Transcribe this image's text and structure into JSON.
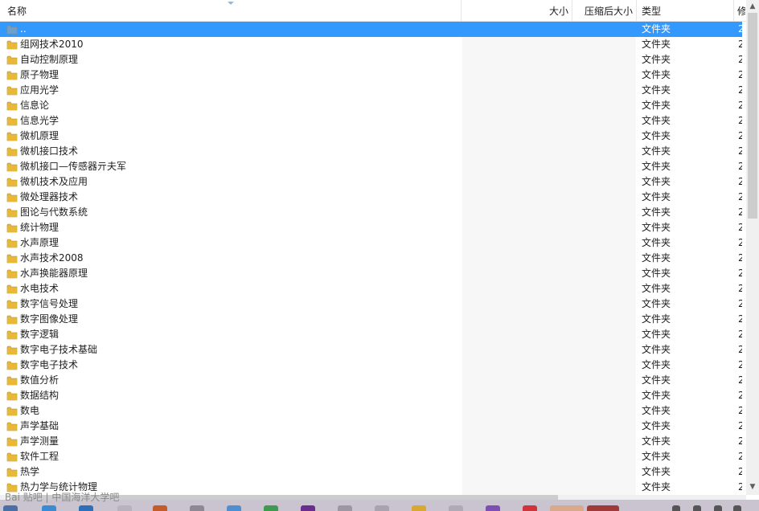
{
  "columns": {
    "name": "名称",
    "size": "大小",
    "compressed_size": "压缩后大小",
    "type": "类型",
    "modified": "修"
  },
  "rows": [
    {
      "name": "..",
      "type": "文件夹",
      "date": "2",
      "selected": true
    },
    {
      "name": "组网技术2010",
      "type": "文件夹",
      "date": "2"
    },
    {
      "name": "自动控制原理",
      "type": "文件夹",
      "date": "2"
    },
    {
      "name": "原子物理",
      "type": "文件夹",
      "date": "2"
    },
    {
      "name": "应用光学",
      "type": "文件夹",
      "date": "2"
    },
    {
      "name": "信息论",
      "type": "文件夹",
      "date": "2"
    },
    {
      "name": "信息光学",
      "type": "文件夹",
      "date": "2"
    },
    {
      "name": "微机原理",
      "type": "文件夹",
      "date": "2"
    },
    {
      "name": "微机接口技术",
      "type": "文件夹",
      "date": "2"
    },
    {
      "name": "微机接口—传感器亓夫军",
      "type": "文件夹",
      "date": "2"
    },
    {
      "name": "微机技术及应用",
      "type": "文件夹",
      "date": "2"
    },
    {
      "name": "微处理器技术",
      "type": "文件夹",
      "date": "2"
    },
    {
      "name": "图论与代数系统",
      "type": "文件夹",
      "date": "2"
    },
    {
      "name": "统计物理",
      "type": "文件夹",
      "date": "2"
    },
    {
      "name": "水声原理",
      "type": "文件夹",
      "date": "2"
    },
    {
      "name": "水声技术2008",
      "type": "文件夹",
      "date": "2"
    },
    {
      "name": "水声换能器原理",
      "type": "文件夹",
      "date": "2"
    },
    {
      "name": "水电技术",
      "type": "文件夹",
      "date": "2"
    },
    {
      "name": "数字信号处理",
      "type": "文件夹",
      "date": "2"
    },
    {
      "name": "数字图像处理",
      "type": "文件夹",
      "date": "2"
    },
    {
      "name": "数字逻辑",
      "type": "文件夹",
      "date": "2"
    },
    {
      "name": "数字电子技术基础",
      "type": "文件夹",
      "date": "2"
    },
    {
      "name": "数字电子技术",
      "type": "文件夹",
      "date": "2"
    },
    {
      "name": "数值分析",
      "type": "文件夹",
      "date": "2"
    },
    {
      "name": "数据结构",
      "type": "文件夹",
      "date": "2"
    },
    {
      "name": "数电",
      "type": "文件夹",
      "date": "2"
    },
    {
      "name": "声学基础",
      "type": "文件夹",
      "date": "2"
    },
    {
      "name": "声学测量",
      "type": "文件夹",
      "date": "2"
    },
    {
      "name": "软件工程",
      "type": "文件夹",
      "date": "2"
    },
    {
      "name": "热学",
      "type": "文件夹",
      "date": "2"
    },
    {
      "name": "热力学与统计物理",
      "type": "文件夹",
      "date": "2"
    }
  ],
  "watermark": "Bai 贴吧 | 中国海洋大学吧",
  "colors": {
    "selection": "#3399ff",
    "folder": "#e8b838",
    "folder_up": "#6d9fcf"
  },
  "icons": {
    "folder": "folder-icon",
    "scroll_up": "scroll-up-icon",
    "scroll_down": "scroll-down-icon"
  }
}
